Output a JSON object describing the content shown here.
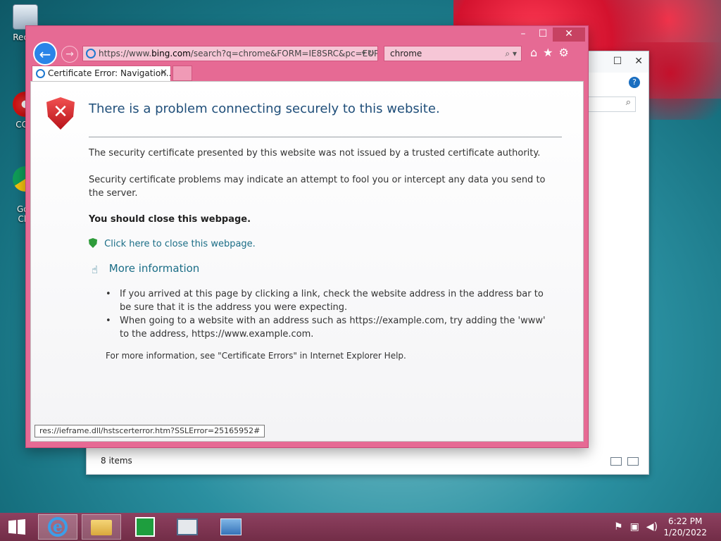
{
  "desktop": {
    "icons": [
      {
        "label": "Recyc"
      },
      {
        "label": "CCle"
      },
      {
        "label": "Goo\nChr"
      }
    ]
  },
  "explorer": {
    "status": "8 items"
  },
  "ie": {
    "address": {
      "prefix": "https://www.",
      "domain": "bing.com",
      "suffix": "/search?q=chrome&FORM=IE8SRC&pc=EUP"
    },
    "search_value": "chrome",
    "tab_title": "Certificate Error: Navigation...",
    "status_url": "res://ieframe.dll/hstscerterror.htm?SSLError=25165952#"
  },
  "page": {
    "title": "There is a problem connecting securely to this website.",
    "para1": "The security certificate presented by this website was not issued by a trusted certificate authority.",
    "para2": "Security certificate problems may indicate an attempt to fool you or intercept any data you send to the server.",
    "advice": "You should close this webpage.",
    "close_link": "Click here to close this webpage.",
    "more_info": "More information",
    "bullets": [
      "If you arrived at this page by clicking a link, check the website address in the address bar to be sure that it is the address you were expecting.",
      "When going to a website with an address such as https://example.com, try adding the 'www' to the address, https://www.example.com."
    ],
    "help_note": "For more information, see \"Certificate Errors\" in Internet Explorer Help."
  },
  "taskbar": {
    "time": "6:22 PM",
    "date": "1/20/2022"
  },
  "colors": {
    "ie_frame": "#e66a94",
    "title_blue": "#1f4e79",
    "link": "#1a6d86",
    "taskbar": "#8a3a58"
  }
}
